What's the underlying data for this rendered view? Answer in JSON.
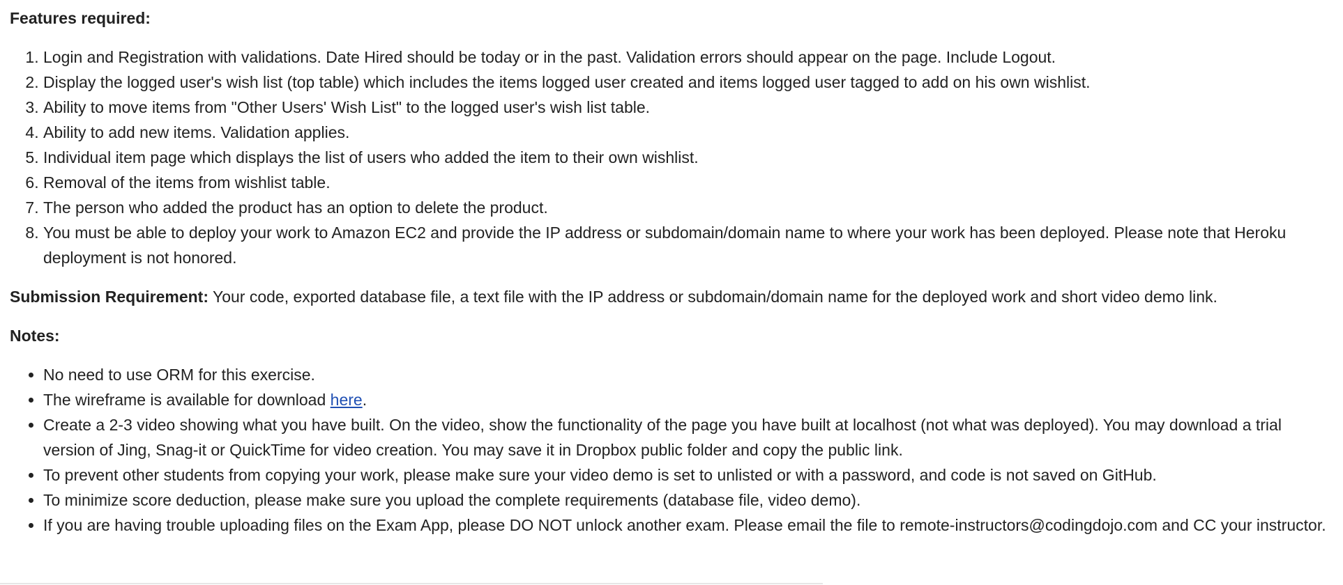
{
  "features": {
    "heading": "Features required:",
    "items": [
      "Login and Registration with validations. Date Hired should be today or in the past. Validation errors should appear on the page. Include Logout.",
      "Display the logged user's wish list (top table) which includes the items logged user created and items logged user tagged to add on his own wishlist.",
      "Ability to move items from \"Other Users' Wish List\" to the logged user's wish list table.",
      "Ability to add new items. Validation applies.",
      "Individual item page which displays the list of users who added the item to their own wishlist.",
      "Removal of the items from wishlist table.",
      "The person who added the product has an option to delete the product.",
      "You must be able to deploy your work to Amazon EC2 and provide the IP address or subdomain/domain name to where your work has been deployed. Please note that Heroku deployment is not honored."
    ]
  },
  "submission": {
    "label": "Submission Requirement:",
    "text": " Your code, exported database file, a text file with the IP address or subdomain/domain name for the deployed work and short video demo link."
  },
  "notes": {
    "heading": "Notes:",
    "item_0": "No need to use ORM for this exercise.",
    "item_1_prefix": "The wireframe is available for download ",
    "item_1_link": "here",
    "item_1_suffix": ".",
    "item_2": "Create a 2-3 video showing what you have built. On the video, show the functionality of the page you have built at localhost (not what was deployed). You may download a trial version of Jing, Snag-it or QuickTime for video creation. You may save it in Dropbox public folder and copy the public link.",
    "item_3": "To prevent other students from copying your work, please make sure your video demo is set to unlisted or with a password, and code is not saved on GitHub.",
    "item_4": "To minimize score deduction, please make sure you upload the complete requirements (database file, video demo).",
    "item_5": "If you are having trouble uploading files on the Exam App, please DO NOT unlock another exam. Please email the file to remote-instructors@codingdojo.com and CC your instructor."
  },
  "colors": {
    "text": "#222222",
    "link": "#1f4fb3"
  }
}
